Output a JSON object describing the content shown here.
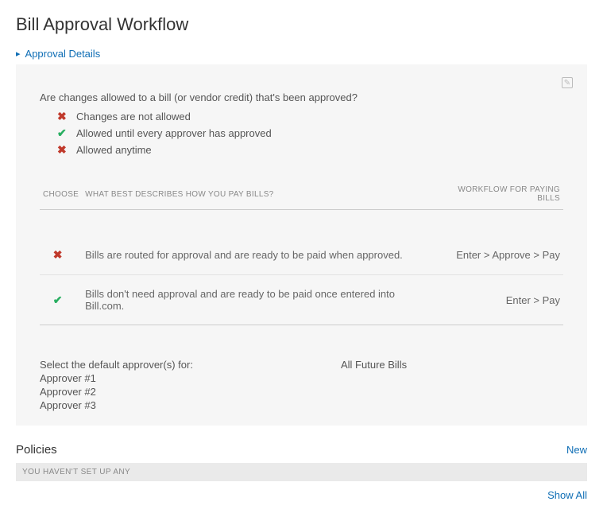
{
  "page": {
    "title": "Bill Approval Workflow",
    "section_link": "Approval Details"
  },
  "details": {
    "question": "Are changes allowed to a bill (or vendor credit) that's been approved?",
    "options": [
      {
        "icon": "cross",
        "label": "Changes are not allowed"
      },
      {
        "icon": "check",
        "label": "Allowed until every approver has approved"
      },
      {
        "icon": "cross",
        "label": "Allowed anytime"
      }
    ],
    "table": {
      "headers": {
        "choose": "CHOOSE",
        "desc": "WHAT BEST DESCRIBES HOW YOU PAY BILLS?",
        "workflow": "WORKFLOW FOR PAYING BILLS"
      },
      "rows": [
        {
          "icon": "cross",
          "desc": "Bills are routed for approval and are ready to be paid when approved.",
          "workflow": "Enter > Approve > Pay"
        },
        {
          "icon": "check",
          "desc": "Bills don't need approval and are ready to be paid once entered into Bill.com.",
          "workflow": "Enter > Pay"
        }
      ]
    },
    "approvers": {
      "label": "Select the default approver(s) for:",
      "scope": "All Future Bills",
      "list": [
        "Approver #1",
        "Approver #2",
        "Approver #3"
      ]
    }
  },
  "policies": {
    "title": "Policies",
    "new_label": "New",
    "empty": "YOU HAVEN'T SET UP ANY",
    "show_all": "Show All"
  }
}
